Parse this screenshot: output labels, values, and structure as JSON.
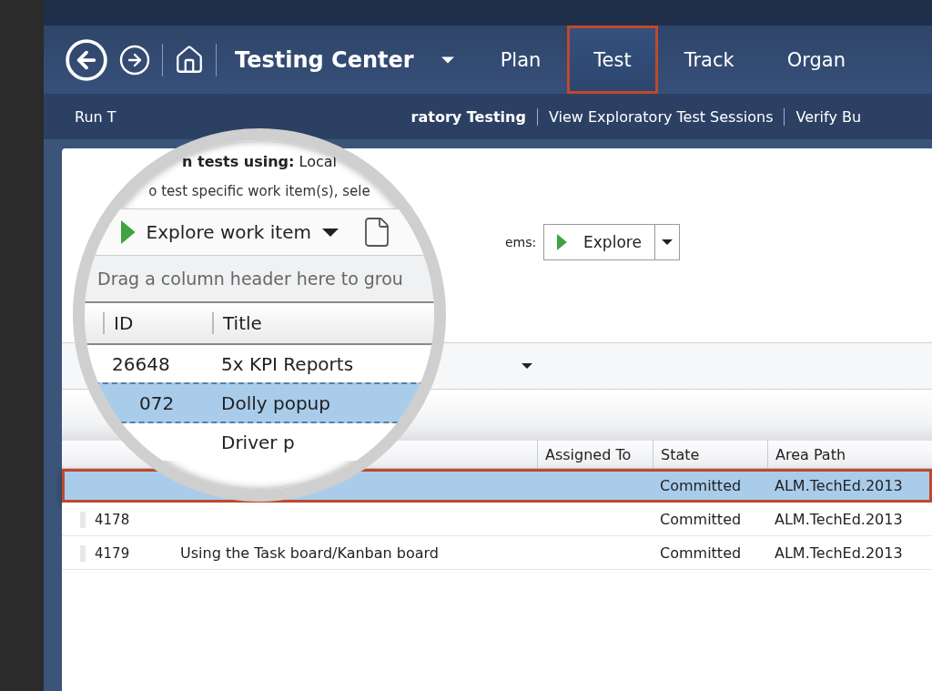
{
  "nav": {
    "title": "Testing Center",
    "tabs": [
      {
        "label": "Plan",
        "selected": false
      },
      {
        "label": "Test",
        "selected": true
      },
      {
        "label": "Track",
        "selected": false
      },
      {
        "label": "Organ",
        "selected": false
      }
    ]
  },
  "subnav": [
    {
      "label": "Run T",
      "selected": false
    },
    {
      "label": "ratory Testing",
      "selected": true
    },
    {
      "label": "View Exploratory Test Sessions",
      "selected": false
    },
    {
      "label": "Verify Bu",
      "selected": false
    }
  ],
  "toolbar": {
    "label": "ems:",
    "button": "Explore"
  },
  "table": {
    "columns": [
      "Assigned To",
      "State",
      "Area Path"
    ],
    "rows": [
      {
        "selected": true,
        "state": "Committed",
        "area_path": "ALM.TechEd.2013"
      },
      {
        "id": "4178",
        "selected": false,
        "state": "Committed",
        "area_path": "ALM.TechEd.2013"
      },
      {
        "id": "4179",
        "title": "Using the Task board/Kanban board",
        "selected": false,
        "state": "Committed",
        "area_path": "ALM.TechEd.2013"
      }
    ]
  },
  "lens": {
    "heading": "**n tests using:** Local",
    "hint": "o test specific work item(s), sele",
    "button": "Explore work item",
    "group_hint": "Drag a column header here to grou",
    "columns": [
      "ID",
      "Title"
    ],
    "rows": [
      {
        "id": "26648",
        "title": "5x KPI Reports",
        "selected": false
      },
      {
        "id": "072",
        "title": "Dolly popup",
        "selected": true
      },
      {
        "title": "Driver p",
        "selected": false
      }
    ]
  }
}
